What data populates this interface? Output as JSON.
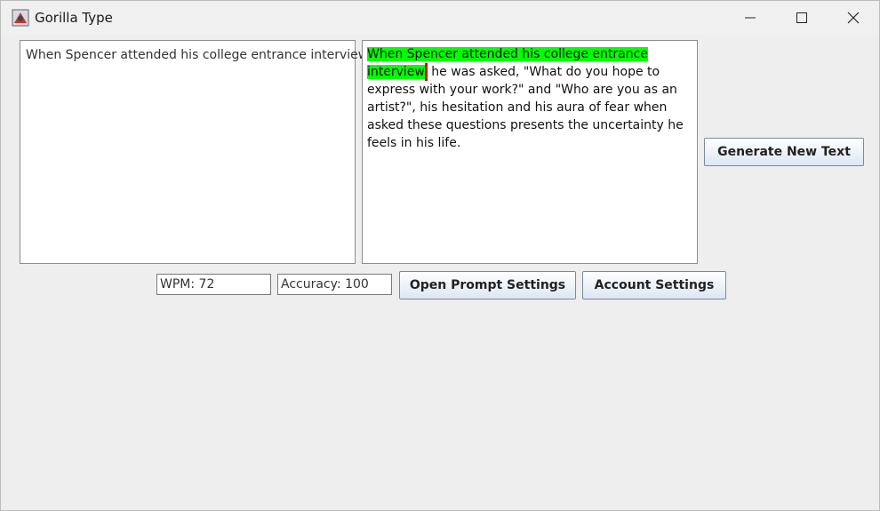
{
  "window": {
    "title": "Gorilla Type",
    "icons": [
      "app-icon",
      "minimize-icon",
      "maximize-icon",
      "close-icon"
    ]
  },
  "typing_area": {
    "typed_text": "When Spencer attended his college entrance interview"
  },
  "prompt_area": {
    "completed_text": "When Spencer attended his college entrance interview",
    "remaining_text": " he was asked, \"What do you hope to express with your work?\" and \"Who are you as an artist?\", his hesitation and his aura of fear when asked these questions presents the uncertainty he feels in his life.",
    "highlight_color": "#00ff00",
    "caret_color": "#e00000"
  },
  "buttons": {
    "generate_label": "Generate New Text",
    "prompt_settings_label": "Open Prompt Settings",
    "account_settings_label": "Account Settings"
  },
  "stats": {
    "wpm": "WPM: 72",
    "accuracy": "Accuracy: 100"
  }
}
